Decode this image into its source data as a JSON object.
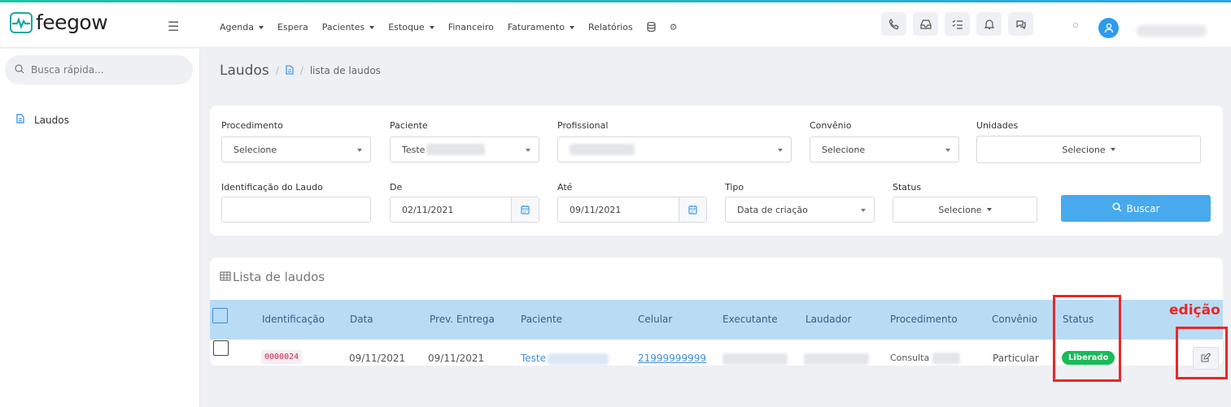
{
  "app": {
    "logo_text": "feegow",
    "brand_color": "#18a8a0",
    "accent_color": "#47a9ee"
  },
  "nav": {
    "items": [
      {
        "label": "Agenda",
        "dropdown": true
      },
      {
        "label": "Espera",
        "dropdown": false
      },
      {
        "label": "Pacientes",
        "dropdown": true
      },
      {
        "label": "Estoque",
        "dropdown": true
      },
      {
        "label": "Financeiro",
        "dropdown": false
      },
      {
        "label": "Faturamento",
        "dropdown": true
      },
      {
        "label": "Relatórios",
        "dropdown": false
      }
    ],
    "icons": [
      "database-icon",
      "gear-icon"
    ],
    "tools": [
      "phone-icon",
      "inbox-icon",
      "checklist-icon",
      "bell-icon",
      "chat-icon"
    ]
  },
  "sidebar": {
    "search_placeholder": "Busca rápida...",
    "items": [
      {
        "label": "Laudos",
        "icon": "document-icon"
      }
    ]
  },
  "breadcrumb": {
    "title": "Laudos",
    "separator": "/",
    "current": "lista de laudos"
  },
  "filters": {
    "procedimento": {
      "label": "Procedimento",
      "value": "Selecione"
    },
    "paciente": {
      "label": "Paciente",
      "value": "Teste"
    },
    "profissional": {
      "label": "Profissional",
      "value": ""
    },
    "convenio": {
      "label": "Convênio",
      "value": "Selecione"
    },
    "unidades": {
      "label": "Unidades",
      "value": "Selecione"
    },
    "identificacao": {
      "label": "Identificação do Laudo",
      "value": ""
    },
    "de": {
      "label": "De",
      "value": "02/11/2021"
    },
    "ate": {
      "label": "Até",
      "value": "09/11/2021"
    },
    "tipo": {
      "label": "Tipo",
      "value": "Data de criação"
    },
    "status": {
      "label": "Status",
      "value": "Selecione"
    },
    "buscar_label": "Buscar"
  },
  "list": {
    "title": "Lista de laudos",
    "columns": [
      "Identificação",
      "Data",
      "Prev. Entrega",
      "Paciente",
      "Celular",
      "Executante",
      "Laudador",
      "Procedimento",
      "Convênio",
      "Status"
    ],
    "rows": [
      {
        "identificacao": "0000024",
        "data": "09/11/2021",
        "prev_entrega": "09/11/2021",
        "paciente": "Teste",
        "celular": "21999999999",
        "executante": "",
        "laudador": "",
        "procedimento": "Consulta",
        "convenio": "Particular",
        "status": "Liberado"
      }
    ]
  },
  "annotation": {
    "label": "edição",
    "color": "#e8282b"
  }
}
